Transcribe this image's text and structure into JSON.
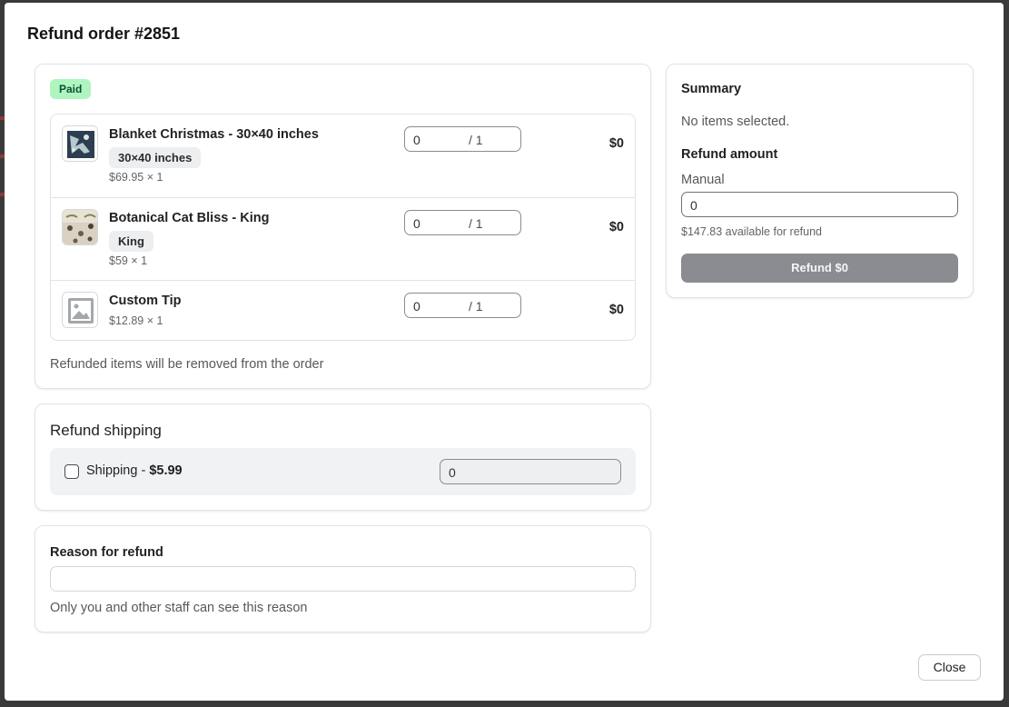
{
  "modal": {
    "title": "Refund order #2851",
    "close_label": "Close"
  },
  "items_card": {
    "status_badge": "Paid",
    "items": [
      {
        "title": "Blanket Christmas - 30×40 inches",
        "variant": "30×40 inches",
        "price_line": "$69.95 × 1",
        "qty_value": "0",
        "qty_max": "/ 1",
        "total": "$0",
        "thumbnail_icon": "blanket-photo-icon"
      },
      {
        "title": "Botanical Cat Bliss - King",
        "variant": "King",
        "price_line": "$59 × 1",
        "qty_value": "0",
        "qty_max": "/ 1",
        "total": "$0",
        "thumbnail_icon": "bedding-photo-icon"
      },
      {
        "title": "Custom Tip",
        "variant": "",
        "price_line": "$12.89 × 1",
        "qty_value": "0",
        "qty_max": "/ 1",
        "total": "$0",
        "thumbnail_icon": "image-placeholder-icon"
      }
    ],
    "footer_note": "Refunded items will be removed from the order"
  },
  "shipping": {
    "title": "Refund shipping",
    "label_prefix": "Shipping - ",
    "label_amount": "$5.99",
    "checked": false,
    "value": "0"
  },
  "reason": {
    "label": "Reason for refund",
    "value": "",
    "helper": "Only you and other staff can see this reason"
  },
  "summary": {
    "title": "Summary",
    "status_text": "No items selected.",
    "refund_amount_title": "Refund amount",
    "manual_label": "Manual",
    "manual_value": "0",
    "available_text": "$147.83 available for refund",
    "refund_button_label": "Refund $0"
  },
  "colors": {
    "paid_badge_bg": "#aef5bf",
    "refund_button_disabled": "#8a8c91"
  }
}
